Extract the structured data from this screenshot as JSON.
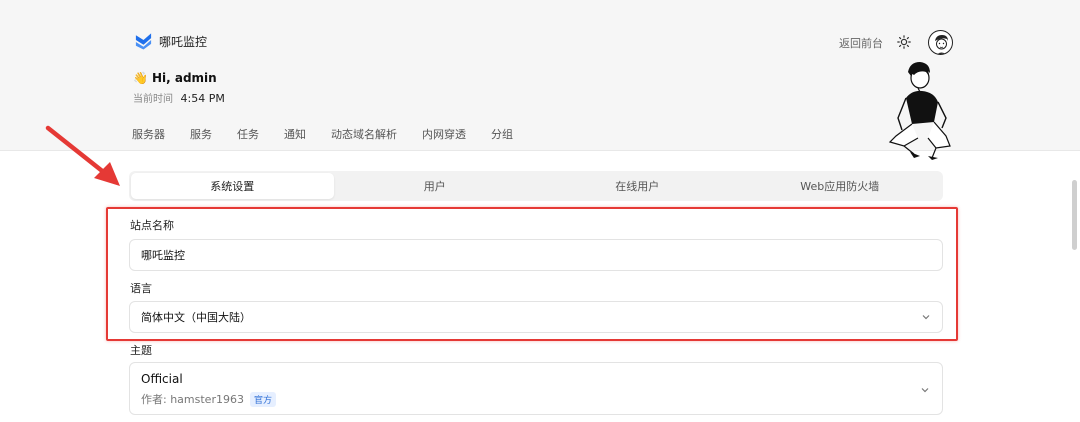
{
  "header": {
    "app_name": "哪吒监控",
    "greeting": "Hi, admin",
    "time_label": "当前时间",
    "time_value": "4:54 PM",
    "back_link": "返回前台",
    "nav": [
      "服务器",
      "服务",
      "任务",
      "通知",
      "动态域名解析",
      "内网穿透",
      "分组"
    ]
  },
  "tabs": [
    {
      "label": "系统设置",
      "active": true
    },
    {
      "label": "用户",
      "active": false
    },
    {
      "label": "在线用户",
      "active": false
    },
    {
      "label": "Web应用防火墙",
      "active": false
    }
  ],
  "form": {
    "site_name_label": "站点名称",
    "site_name_value": "哪吒监控",
    "language_label": "语言",
    "language_value": "简体中文（中国大陆）",
    "theme_label": "主题",
    "theme_name": "Official",
    "theme_author": "作者: hamster1963",
    "theme_badge": "官方"
  },
  "colors": {
    "annotation_red": "#e53935",
    "logo_blue": "#1f6feb",
    "badge_blue": "#2f6fd6"
  }
}
